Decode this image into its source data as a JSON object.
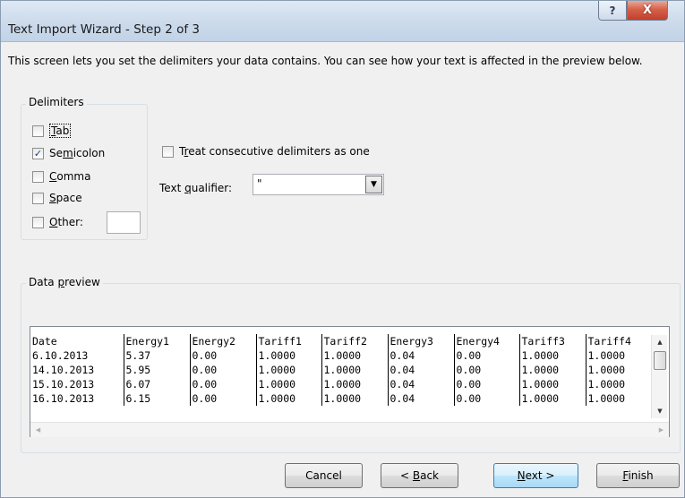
{
  "window": {
    "title": "Text Import Wizard - Step 2 of 3",
    "help_glyph": "?",
    "close_glyph": "X"
  },
  "intro": "This screen lets you set the delimiters your data contains.  You can see how your text is affected in the preview below.",
  "delimiters": {
    "legend": "Delimiters",
    "tab": {
      "pre": "",
      "u": "T",
      "post": "ab",
      "checked": false
    },
    "semicolon": {
      "pre": "Se",
      "u": "m",
      "post": "icolon",
      "checked": true
    },
    "comma": {
      "pre": "",
      "u": "C",
      "post": "omma",
      "checked": false
    },
    "space": {
      "pre": "",
      "u": "S",
      "post": "pace",
      "checked": false
    },
    "other": {
      "pre": "",
      "u": "O",
      "post": "ther:",
      "checked": false,
      "value": ""
    }
  },
  "consecutive": {
    "pre": "T",
    "u": "r",
    "post": "eat consecutive delimiters as one",
    "checked": false
  },
  "qualifier": {
    "pre": "Text ",
    "u": "q",
    "post": "ualifier:",
    "value": "\""
  },
  "preview": {
    "legend_pre": "Data ",
    "legend_u": "p",
    "legend_post": "review",
    "headers": [
      "Date",
      "Energy1",
      "Energy2",
      "Tariff1",
      "Tariff2",
      "Energy3",
      "Energy4",
      "Tariff3",
      "Tariff4"
    ],
    "rows": [
      [
        "6.10.2013",
        "5.37",
        "0.00",
        "1.0000",
        "1.0000",
        "0.04",
        "0.00",
        "1.0000",
        "1.0000"
      ],
      [
        "14.10.2013",
        "5.95",
        "0.00",
        "1.0000",
        "1.0000",
        "0.04",
        "0.00",
        "1.0000",
        "1.0000"
      ],
      [
        "15.10.2013",
        "6.07",
        "0.00",
        "1.0000",
        "1.0000",
        "0.04",
        "0.00",
        "1.0000",
        "1.0000"
      ],
      [
        "16.10.2013",
        "6.15",
        "0.00",
        "1.0000",
        "1.0000",
        "0.04",
        "0.00",
        "1.0000",
        "1.0000"
      ]
    ]
  },
  "buttons": {
    "cancel": {
      "pre": "Cancel",
      "u": "",
      "post": ""
    },
    "back": {
      "pre": "< ",
      "u": "B",
      "post": "ack"
    },
    "next": {
      "pre": "",
      "u": "N",
      "post": "ext >"
    },
    "finish": {
      "pre": "",
      "u": "F",
      "post": "inish"
    }
  }
}
